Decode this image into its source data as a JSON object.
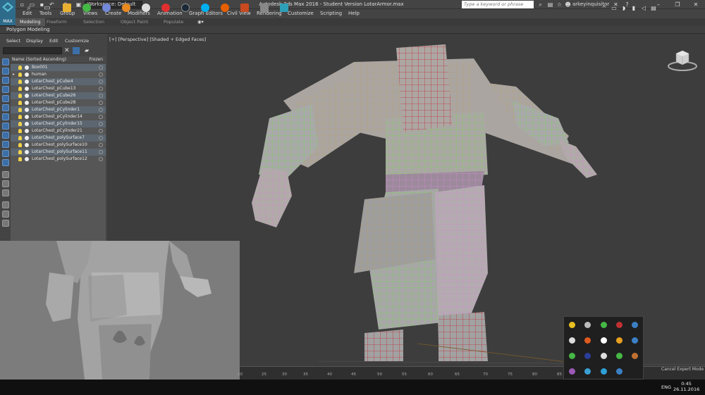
{
  "app": {
    "logo_text": "MAX",
    "window_title": "Autodesk 3ds Max 2016 - Student Version    LotarArmor.max",
    "workspace": "Workspace: Default",
    "search_placeholder": "Type a keyword or phrase",
    "user": "arkeyinquisitor"
  },
  "menu": [
    "Edit",
    "Tools",
    "Group",
    "Views",
    "Create",
    "Modifiers",
    "Animation",
    "Graph Editors",
    "Civil View",
    "Rendering",
    "Customize",
    "Scripting",
    "Help"
  ],
  "ribbon": {
    "tabs": [
      "Modeling",
      "Freeform",
      "Selection",
      "Object Paint",
      "Populate"
    ],
    "active": "Modeling",
    "panel_label": "Polygon Modeling"
  },
  "scene_explorer": {
    "tabs": [
      "Select",
      "Display",
      "Edit",
      "Customize"
    ],
    "col_name": "Name (Sorted Ascending)",
    "col_frozen": "Frozen",
    "items": [
      "Box001",
      "human",
      "LotarChest_pCube4",
      "LotarChest_pCube13",
      "LotarChest_pCube26",
      "LotarChest_pCube28",
      "LotarChest_pCylinder1",
      "LotarChest_pCylinder14",
      "LotarChest_pCylinder15",
      "LotarChest_pCylinder21",
      "LotarChest_polySurface7",
      "LotarChest_polySurface10",
      "LotarChest_polySurface11",
      "LotarChest_polySurface12"
    ]
  },
  "viewport": {
    "label": "[+] [Perspective] [Shaded + Edged Faces]"
  },
  "timeline": {
    "ticks": [
      "20",
      "25",
      "30",
      "35",
      "40",
      "45",
      "50",
      "55",
      "60",
      "65",
      "70",
      "75",
      "80",
      "85"
    ],
    "cancel_expert": "Cancel Expert Mode"
  },
  "taskbar": {
    "lang": "ENG",
    "time": "0:45",
    "date": "26.11.2016"
  },
  "colors": {
    "accent": "#3c6fa8",
    "viewport_bg": "#3d3d3d",
    "mesh_green": "#7dd35a",
    "mesh_red": "#c0303a",
    "mesh_pink": "#d48ad0",
    "mesh_yellow": "#c8a43a"
  },
  "tray_icons": [
    "#e8c020",
    "#bbbbbb",
    "#45b845",
    "#c03030",
    "#3b7fc4",
    "#dddddd",
    "#e05a20",
    "#ffffff",
    "#e8a020",
    "#3b7fc4",
    "#45b845",
    "#2b3e9a",
    "#dddddd",
    "#45b845",
    "#c07030",
    "#9b59b6",
    "#3b9fd4",
    "#2ea0d8",
    "#3b7fc4"
  ]
}
